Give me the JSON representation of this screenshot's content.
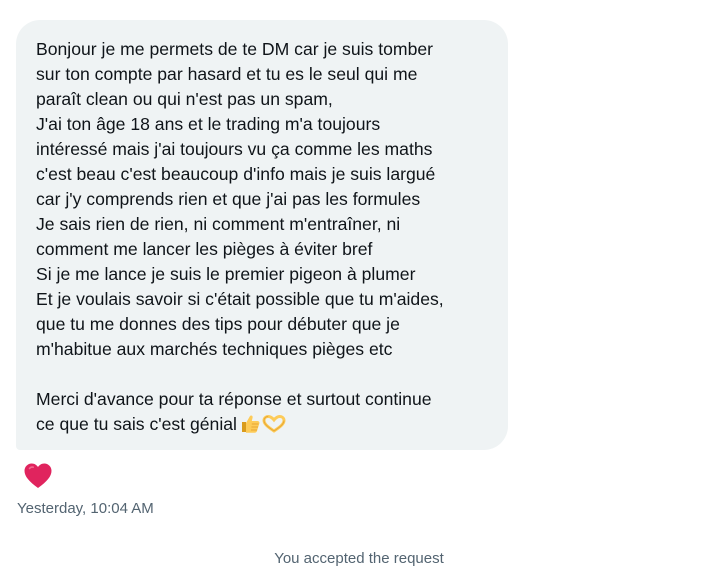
{
  "message": {
    "lines": [
      "Bonjour je me permets de te DM car je suis tomber",
      "sur ton compte par hasard et tu es le seul qui me",
      "paraît clean ou qui n'est pas un spam,",
      "J'ai ton âge 18 ans et le trading m'a toujours",
      "intéressé mais j'ai toujours vu ça comme les maths",
      "c'est beau c'est beaucoup d'info mais je suis largué",
      "car j'y comprends rien et que j'ai pas les formules",
      "Je sais rien de rien, ni comment m'entraîner, ni",
      "comment me lancer les pièges à éviter bref",
      "Si je me lance je suis le premier pigeon à plumer",
      "Et je voulais savoir si c'était possible que tu m'aides,",
      "que tu me donnes des tips pour débuter que je",
      "m'habitue aux marchés techniques pièges etc",
      "Merci d'avance pour ta réponse et surtout continue",
      "ce que tu sais c'est génial"
    ],
    "emojis": [
      "thumbs-up-emoji",
      "heart-hands-emoji"
    ],
    "reaction_icon": "red-heart-icon",
    "timestamp": "Yesterday, 10:04 AM"
  },
  "system_note": "You accepted the request",
  "colors": {
    "bubble_bg": "#eff3f4",
    "text": "#0f1419",
    "secondary_text": "#536471",
    "heart": "#e0245e"
  }
}
